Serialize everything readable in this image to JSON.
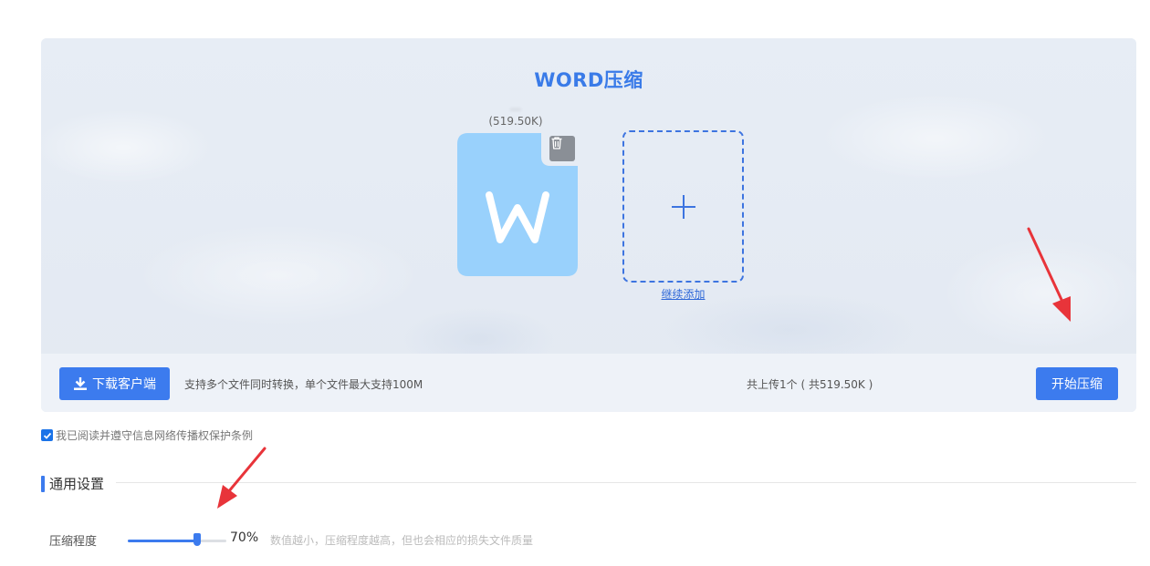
{
  "panel": {
    "title": "WORD压缩",
    "file": {
      "name": "…",
      "size": "(519.50K)",
      "type_icon": "word-file-icon"
    },
    "add_more_label": "继续添加"
  },
  "bottom_bar": {
    "download_label": "下载客户端",
    "support_hint": "支持多个文件同时转换，单个文件最大支持100M",
    "upload_summary": "共上传1个 ( 共519.50K )",
    "start_label": "开始压缩"
  },
  "agreement": {
    "checked": true,
    "label": "我已阅读并遵守信息网络传播权保护条例"
  },
  "settings": {
    "section_title": "通用设置",
    "compression": {
      "label": "压缩程度",
      "value": 70,
      "value_text": "70%",
      "hint": "数值越小，压缩程度越高，但也会相应的损失文件质量"
    }
  },
  "colors": {
    "accent": "#3c7bee",
    "title": "#3a7be8",
    "file_icon": "#99d1fc",
    "annotation_arrow": "#e8343a"
  }
}
